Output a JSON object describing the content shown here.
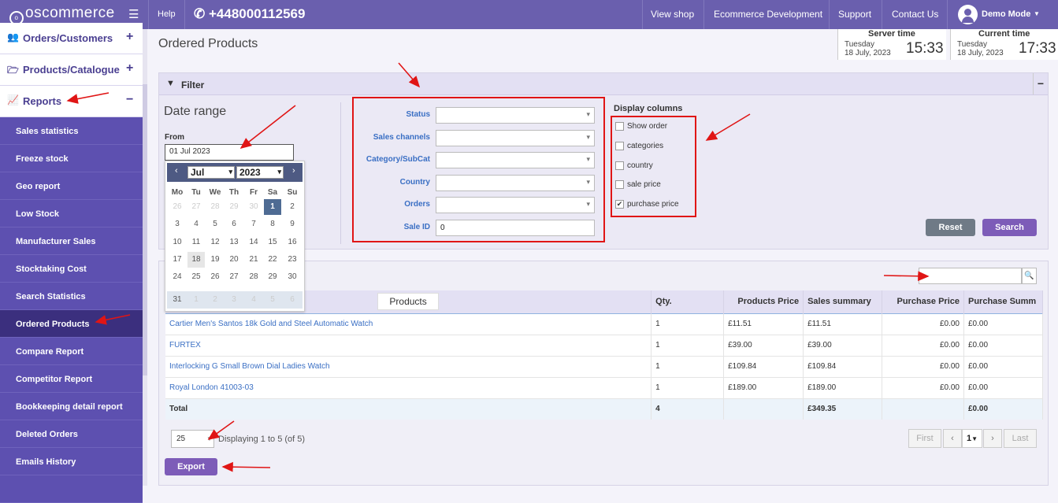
{
  "topbar": {
    "brand": "oscommerce",
    "help": "Help",
    "phone": "+448000112569",
    "nav": [
      "View shop",
      "Ecommerce Development",
      "Support",
      "Contact Us"
    ],
    "user": "Demo Mode"
  },
  "sidebar": {
    "sections": [
      {
        "label": "Orders/Customers",
        "toggle": "+"
      },
      {
        "label": "Products/Catalogue",
        "toggle": "+"
      },
      {
        "label": "Reports",
        "toggle": "−"
      }
    ],
    "items": [
      "Sales statistics",
      "Freeze stock",
      "Geo report",
      "Low Stock",
      "Manufacturer Sales",
      "Stocktaking Cost",
      "Search Statistics",
      "Ordered Products",
      "Compare Report",
      "Competitor Report",
      "Bookkeeping detail report",
      "Deleted Orders",
      "Emails History"
    ],
    "active_item": "Ordered Products"
  },
  "page": {
    "title": "Ordered Products",
    "server_time": {
      "label": "Server time",
      "day": "Tuesday",
      "date": "18 July, 2023",
      "time": "15:33"
    },
    "current_time": {
      "label": "Current time",
      "day": "Tuesday",
      "date": "18 July, 2023",
      "time": "17:33"
    }
  },
  "filter": {
    "title": "Filter",
    "collapse": "−",
    "date_range": "Date range",
    "from_label": "From",
    "from_value": "01 Jul 2023",
    "calendar": {
      "prev": "‹",
      "next": "›",
      "month": "Jul",
      "year": "2023",
      "weekdays": [
        "Mo",
        "Tu",
        "We",
        "Th",
        "Fr",
        "Sa",
        "Su"
      ],
      "rows": [
        [
          "26",
          "27",
          "28",
          "29",
          "30",
          "1",
          "2"
        ],
        [
          "3",
          "4",
          "5",
          "6",
          "7",
          "8",
          "9"
        ],
        [
          "10",
          "11",
          "12",
          "13",
          "14",
          "15",
          "16"
        ],
        [
          "17",
          "18",
          "19",
          "20",
          "21",
          "22",
          "23"
        ],
        [
          "24",
          "25",
          "26",
          "27",
          "28",
          "29",
          "30"
        ],
        [
          "31",
          "1",
          "2",
          "3",
          "4",
          "5",
          "6"
        ]
      ],
      "selected": "1",
      "today": "18"
    },
    "fields": [
      {
        "label": "Status",
        "value": ""
      },
      {
        "label": "Sales channels",
        "value": ""
      },
      {
        "label": "Category/SubCat",
        "value": ""
      },
      {
        "label": "Country",
        "value": ""
      },
      {
        "label": "Orders",
        "value": ""
      },
      {
        "label": "Sale ID",
        "value": "0"
      }
    ],
    "display_columns": {
      "title": "Display columns",
      "options": [
        {
          "label": "Show order",
          "checked": false
        },
        {
          "label": "categories",
          "checked": false
        },
        {
          "label": "country",
          "checked": false
        },
        {
          "label": "sale price",
          "checked": false
        },
        {
          "label": "purchase price",
          "checked": true
        }
      ]
    },
    "reset": "Reset",
    "search": "Search"
  },
  "table": {
    "columns": [
      "Products",
      "Qty.",
      "Products Price",
      "Sales summary",
      "Purchase Price",
      "Purchase Summ"
    ],
    "rows": [
      [
        "Cartier Men's Santos 18k Gold and Steel Automatic Watch",
        "1",
        "£11.51",
        "£11.51",
        "£0.00",
        "£0.00"
      ],
      [
        "FURTEX",
        "1",
        "£39.00",
        "£39.00",
        "£0.00",
        "£0.00"
      ],
      [
        "Interlocking G Small Brown Dial Ladies Watch",
        "1",
        "£109.84",
        "£109.84",
        "£0.00",
        "£0.00"
      ],
      [
        "Royal London 41003-03",
        "1",
        "£189.00",
        "£189.00",
        "£0.00",
        "£0.00"
      ]
    ],
    "total": [
      "Total",
      "4",
      "",
      "£349.35",
      "",
      "£0.00"
    ]
  },
  "pagination": {
    "per_page": "25",
    "displaying": "Displaying 1 to 5 (of 5)",
    "first": "First",
    "prev": "‹",
    "page": "1",
    "next": "›",
    "last": "Last"
  },
  "export": "Export",
  "colors": {
    "topbar": "#6a5fae",
    "sidebar": "#5d50b0",
    "sidebar_active": "#3b2f7e",
    "accent_button": "#7d5cb8",
    "reset_button": "#6f7a86",
    "link": "#3a6fc4",
    "annotation": "#e01515"
  }
}
